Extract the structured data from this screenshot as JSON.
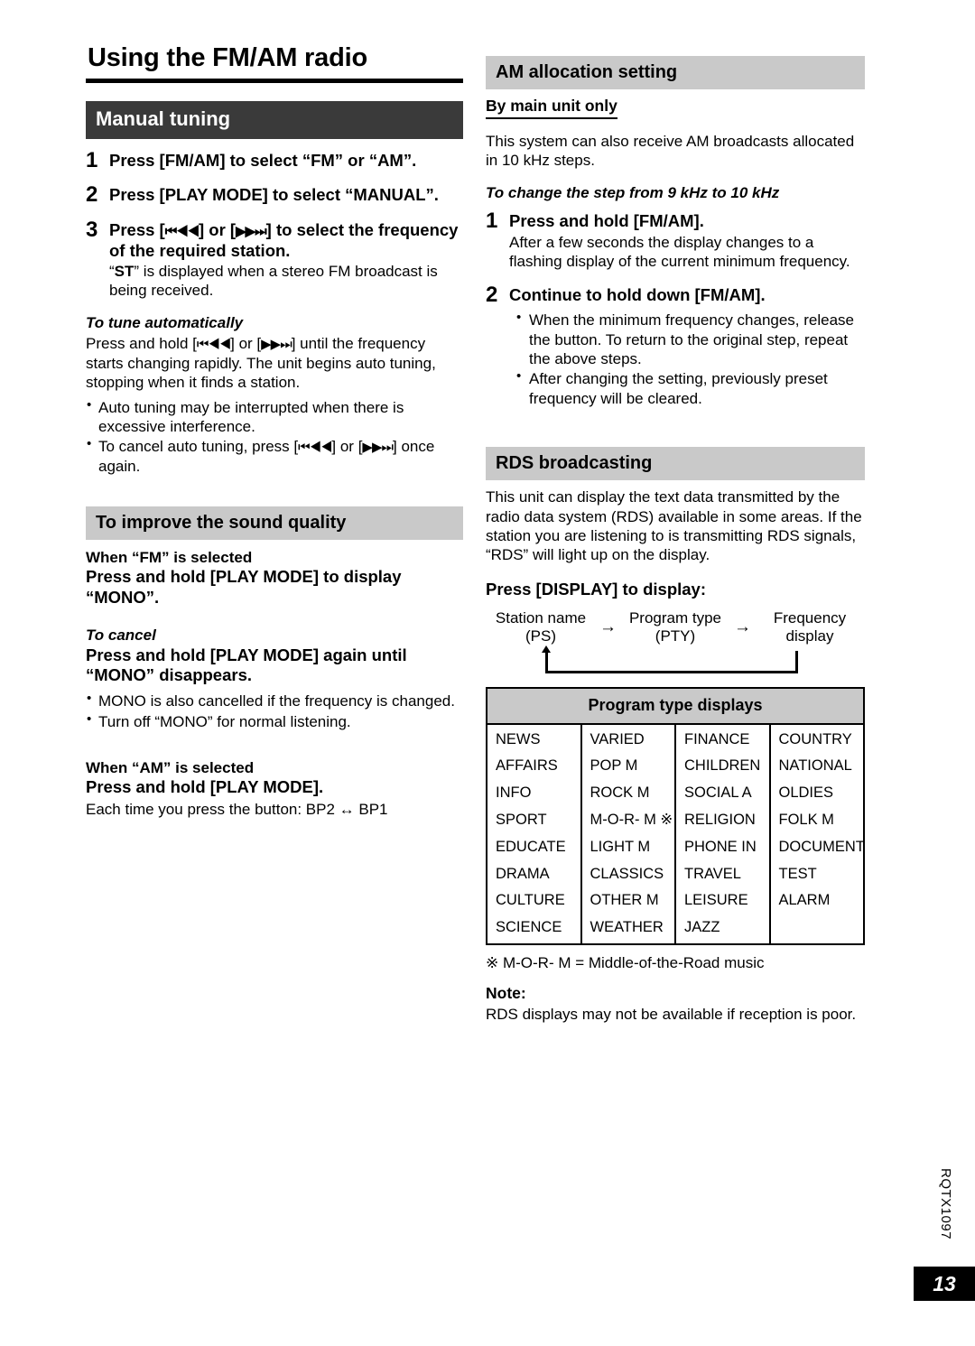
{
  "page_title": "Using the FM/AM radio",
  "left_column": {
    "manual_tuning": {
      "heading": "Manual tuning",
      "steps": [
        {
          "num": "1",
          "head": "Press [FM/AM] to select “FM” or “AM”."
        },
        {
          "num": "2",
          "head": "Press [PLAY MODE] to select “MANUAL”."
        },
        {
          "num": "3",
          "head_part1": "Press [",
          "head_glyph1": "⏮◀◀",
          "head_mid": "] or [",
          "head_glyph2": "▶▶⏭",
          "head_part2": "] to select the frequency of the required station.",
          "sub_pre": "“",
          "sub_bold": "ST",
          "sub_post": "” is displayed when a stereo FM broadcast is being received."
        }
      ],
      "auto_tune": {
        "heading": "To tune automatically",
        "body_pre": "Press and hold [",
        "body_glyph1": "⏮◀◀",
        "body_mid": "] or [",
        "body_glyph2": "▶▶⏭",
        "body_post": "] until the frequency starts changing rapidly. The unit begins auto tuning, stopping when it finds a station.",
        "bullets": [
          {
            "text": "Auto tuning may be interrupted when there is excessive interference."
          },
          {
            "pre": "To cancel auto tuning, press [",
            "glyph1": "⏮◀◀",
            "mid": "] or [",
            "glyph2": "▶▶⏭",
            "post": "] once again."
          }
        ]
      }
    },
    "sound_quality": {
      "heading": "To improve the sound quality",
      "fm_label": "When “FM” is selected",
      "fm_instruction": "Press and hold [PLAY MODE] to display “MONO”.",
      "cancel_label": "To cancel",
      "cancel_instruction": "Press and hold [PLAY MODE] again until “MONO” disappears.",
      "cancel_bullets": [
        "MONO is also cancelled if the frequency is changed.",
        "Turn off “MONO” for normal listening."
      ],
      "am_label": "When “AM” is selected",
      "am_instruction": "Press and hold [PLAY MODE].",
      "am_note": "Each time you press the button: BP2 ↔ BP1"
    }
  },
  "right_column": {
    "am_allocation": {
      "heading": "AM allocation setting",
      "by_main_unit": "By main unit only",
      "intro": "This system can also receive AM broadcasts allocated in 10 kHz steps.",
      "change_step_heading": "To change the step from 9 kHz to 10 kHz",
      "steps": [
        {
          "num": "1",
          "head": "Press and hold [FM/AM].",
          "sub": "After a few seconds the display changes to a flashing display of the current minimum frequency."
        },
        {
          "num": "2",
          "head": "Continue to hold down [FM/AM].",
          "bullets": [
            "When the minimum frequency changes, release the button. To return to the original step, repeat the above steps.",
            "After changing the setting, previously preset frequency will be cleared."
          ]
        }
      ]
    },
    "rds": {
      "heading": "RDS broadcasting",
      "intro": "This unit can display the text data transmitted by the radio data system (RDS) available in some areas. If the station you are listening to is transmitting RDS signals, “RDS” will light up on the display.",
      "display_instruction": "Press [DISPLAY] to display:",
      "flow": {
        "nodes": [
          "Station name (PS)",
          "Program type (PTY)",
          "Frequency display"
        ],
        "arrow": "→"
      },
      "table": {
        "title": "Program type displays",
        "rows": [
          [
            "NEWS",
            "VARIED",
            "FINANCE",
            "COUNTRY"
          ],
          [
            "AFFAIRS",
            "POP M",
            "CHILDREN",
            "NATIONAL"
          ],
          [
            "INFO",
            "ROCK M",
            "SOCIAL A",
            "OLDIES"
          ],
          [
            "SPORT",
            "M-O-R- M ※",
            "RELIGION",
            "FOLK M"
          ],
          [
            "EDUCATE",
            "LIGHT M",
            "PHONE IN",
            "DOCUMENT"
          ],
          [
            "DRAMA",
            "CLASSICS",
            "TRAVEL",
            "TEST"
          ],
          [
            "CULTURE",
            "OTHER M",
            "LEISURE",
            "ALARM"
          ],
          [
            "SCIENCE",
            "WEATHER",
            "JAZZ",
            ""
          ]
        ]
      },
      "footnote": "※ M-O-R- M = Middle-of-the-Road music",
      "note_label": "Note:",
      "note_text": "RDS displays may not be available if reception is poor."
    }
  },
  "footer": {
    "doc_code": "RQTX1097",
    "page_number": "13"
  }
}
